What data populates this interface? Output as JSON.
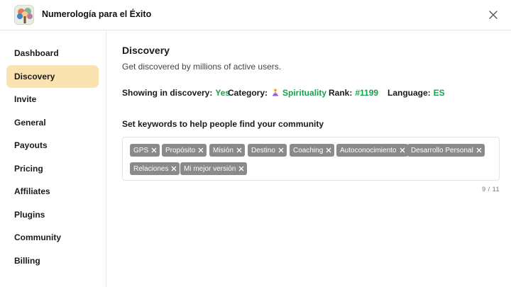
{
  "header": {
    "title": "Numerología para el Éxito",
    "app_icon": "tree-logo-icon",
    "close_icon": "close-icon"
  },
  "sidebar": {
    "items": [
      {
        "label": "Dashboard",
        "active": false
      },
      {
        "label": "Discovery",
        "active": true
      },
      {
        "label": "Invite",
        "active": false
      },
      {
        "label": "General",
        "active": false
      },
      {
        "label": "Payouts",
        "active": false
      },
      {
        "label": "Pricing",
        "active": false
      },
      {
        "label": "Affiliates",
        "active": false
      },
      {
        "label": "Plugins",
        "active": false
      },
      {
        "label": "Community",
        "active": false
      },
      {
        "label": "Billing",
        "active": false
      }
    ]
  },
  "main": {
    "title": "Discovery",
    "subtitle": "Get discovered by millions of active users.",
    "stats": {
      "showing_label": "Showing in discovery:",
      "showing_value": "Yes",
      "category_label": "Category:",
      "category_value": "Spirituality",
      "category_icon": "spirituality-icon",
      "rank_label": "Rank:",
      "rank_value": "#1199",
      "language_label": "Language:",
      "language_value": "ES"
    },
    "keywords_label": "Set keywords to help people find your community",
    "keywords": [
      "GPS",
      "Propósito",
      "Misión",
      "Destino",
      "Coaching",
      "Autoconocimiento",
      "Desarrollo Personal",
      "Relaciones",
      "Mi mejor versión"
    ],
    "counter": "9 / 11"
  },
  "colors": {
    "accent_green": "#16a34a",
    "active_nav_bg": "#fbe2b1",
    "tag_bg": "#8a8a8a"
  }
}
